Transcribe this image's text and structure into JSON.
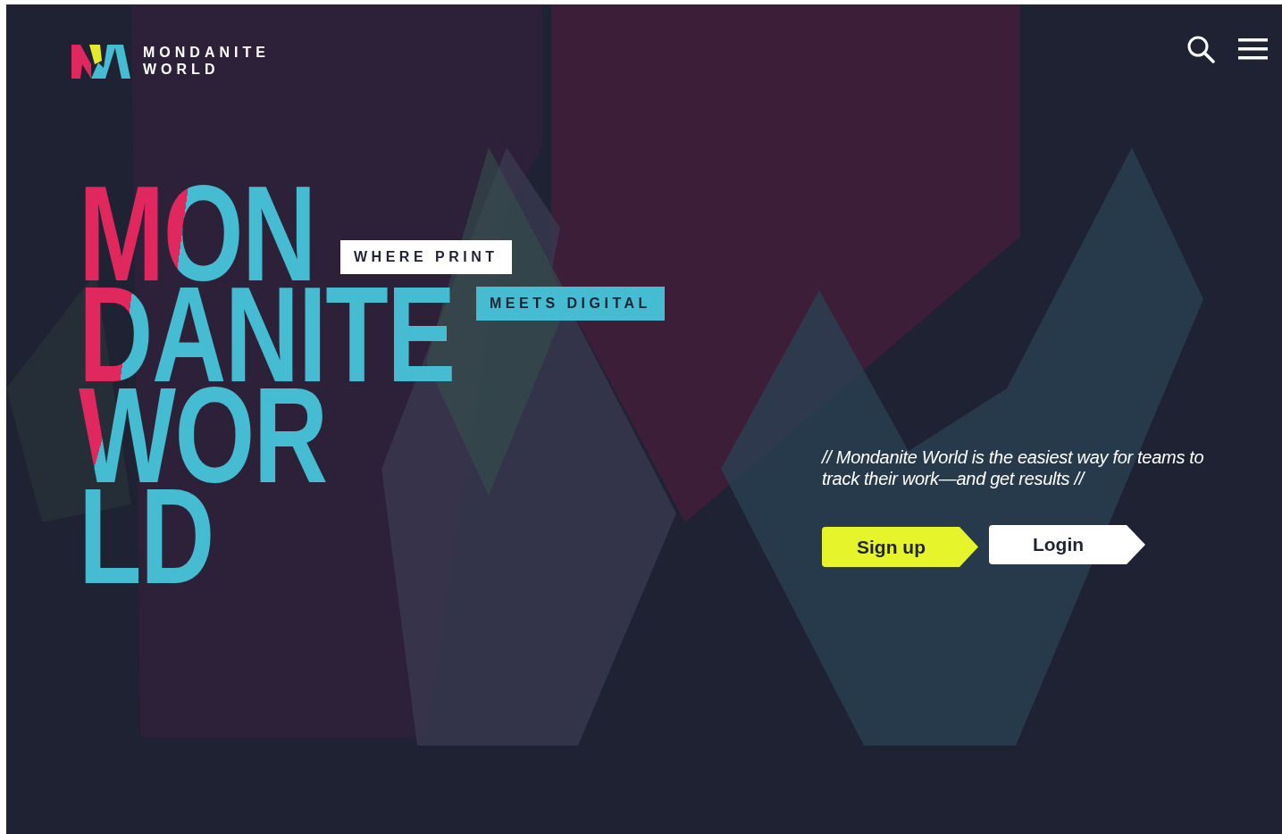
{
  "logo": {
    "line_1": "MONDANITE",
    "line_2": "WORLD"
  },
  "header_icons": [
    {
      "kind": "search"
    },
    {
      "kind": "menu"
    }
  ],
  "hero": {
    "title_lines": [
      "MON",
      "DANITE",
      "WOR",
      "LD"
    ],
    "tags": [
      {
        "text": "WHERE PRINT",
        "kind": "light"
      },
      {
        "text": "MEETS DIGITAL",
        "kind": "accent"
      }
    ],
    "tagline": "// Mondanite World is the easiest way for teams to track their work—and get results //",
    "buttons": [
      {
        "label": "Sign up",
        "kind": "primary"
      },
      {
        "label": "Login",
        "kind": "secondary"
      }
    ]
  }
}
